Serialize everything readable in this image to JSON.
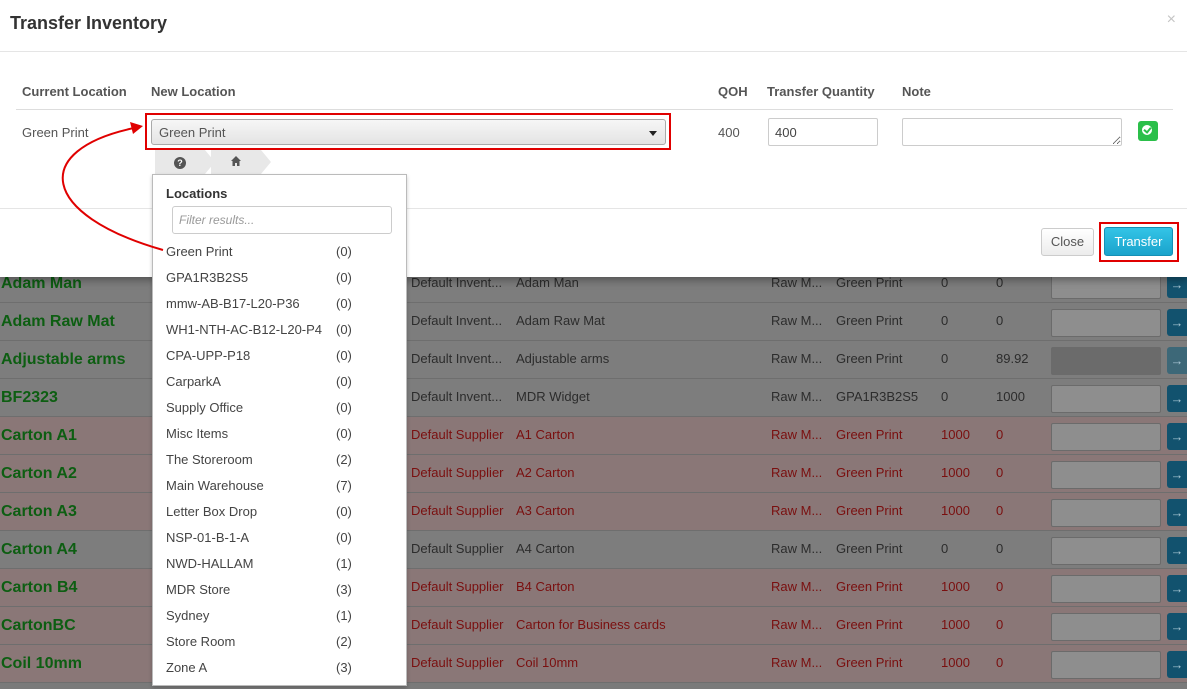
{
  "modal": {
    "title": "Transfer Inventory",
    "close_icon": "×",
    "columns": [
      "Current Location",
      "New Location",
      "QOH",
      "Transfer Quantity",
      "Note"
    ],
    "current_location": "Green Print",
    "new_location": "Green Print",
    "qoh": "400",
    "transfer_quantity": "400",
    "note": "",
    "close_label": "Close",
    "transfer_label": "Transfer"
  },
  "dropdown": {
    "title": "Locations",
    "filter_placeholder": "Filter results...",
    "items": [
      {
        "label": "Green Print",
        "count": "(0)"
      },
      {
        "label": "GPA1R3B2S5",
        "count": "(0)"
      },
      {
        "label": "mmw-AB-B17-L20-P36",
        "count": "(0)"
      },
      {
        "label": "WH1-NTH-AC-B12-L20-P4",
        "count": "(0)"
      },
      {
        "label": "CPA-UPP-P18",
        "count": "(0)"
      },
      {
        "label": "CarparkA",
        "count": "(0)"
      },
      {
        "label": "Supply Office",
        "count": "(0)"
      },
      {
        "label": "Misc Items",
        "count": "(0)"
      },
      {
        "label": "The Storeroom",
        "count": "(2)"
      },
      {
        "label": "Main Warehouse",
        "count": "(7)"
      },
      {
        "label": "Letter Box Drop",
        "count": "(0)"
      },
      {
        "label": "NSP-01-B-1-A",
        "count": "(0)"
      },
      {
        "label": "NWD-HALLAM",
        "count": "(1)"
      },
      {
        "label": "MDR Store",
        "count": "(3)"
      },
      {
        "label": "Sydney",
        "count": "(1)"
      },
      {
        "label": "Store Room",
        "count": "(2)"
      },
      {
        "label": "Zone A",
        "count": "(3)"
      }
    ],
    "breadcrumb_icons": [
      "question-icon",
      "home-icon"
    ]
  },
  "background_rows": [
    {
      "name": "Adam Man",
      "supplier": "Default Invent...",
      "desc": "Adam Man",
      "type": "Raw M...",
      "location": "Green Print",
      "q1": "0",
      "q2": "0",
      "red": false
    },
    {
      "name": "Adam Raw Mat",
      "supplier": "Default Invent...",
      "desc": "Adam Raw Mat",
      "type": "Raw M...",
      "location": "Green Print",
      "q1": "0",
      "q2": "0",
      "red": false
    },
    {
      "name": "Adjustable arms",
      "supplier": "Default Invent...",
      "desc": "Adjustable arms",
      "type": "Raw M...",
      "location": "Green Print",
      "q1": "0",
      "q2": "89.92",
      "red": false
    },
    {
      "name": "BF2323",
      "supplier": "Default Invent...",
      "desc": "MDR Widget",
      "type": "Raw M...",
      "location": "GPA1R3B2S5",
      "q1": "0",
      "q2": "1000",
      "red": false
    },
    {
      "name": "Carton A1",
      "supplier": "Default Supplier",
      "desc": "A1 Carton",
      "type": "Raw M...",
      "location": "Green Print",
      "q1": "1000",
      "q2": "0",
      "red": true
    },
    {
      "name": "Carton A2",
      "supplier": "Default Supplier",
      "desc": "A2 Carton",
      "type": "Raw M...",
      "location": "Green Print",
      "q1": "1000",
      "q2": "0",
      "red": true
    },
    {
      "name": "Carton A3",
      "supplier": "Default Supplier",
      "desc": "A3 Carton",
      "type": "Raw M...",
      "location": "Green Print",
      "q1": "1000",
      "q2": "0",
      "red": true
    },
    {
      "name": "Carton A4",
      "supplier": "Default Supplier",
      "desc": "A4 Carton",
      "type": "Raw M...",
      "location": "Green Print",
      "q1": "0",
      "q2": "0",
      "red": false
    },
    {
      "name": "Carton B4",
      "supplier": "Default Supplier",
      "desc": "B4 Carton",
      "type": "Raw M...",
      "location": "Green Print",
      "q1": "1000",
      "q2": "0",
      "red": true
    },
    {
      "name": "CartonBC",
      "supplier": "Default Supplier",
      "desc": "Carton for Business cards",
      "type": "Raw M...",
      "location": "Green Print",
      "q1": "1000",
      "q2": "0",
      "red": true
    },
    {
      "name": "Coil 10mm",
      "supplier": "Default Supplier",
      "desc": "Coil 10mm",
      "type": "Raw M...",
      "location": "Green Print",
      "q1": "1000",
      "q2": "0",
      "red": true
    }
  ],
  "row_action_glyph": "→",
  "colors": {
    "highlight": "#e00000",
    "transfer_button": "#1aa3cc",
    "confirm_button": "#2bbf4a",
    "item_name": "#0d5e12"
  }
}
